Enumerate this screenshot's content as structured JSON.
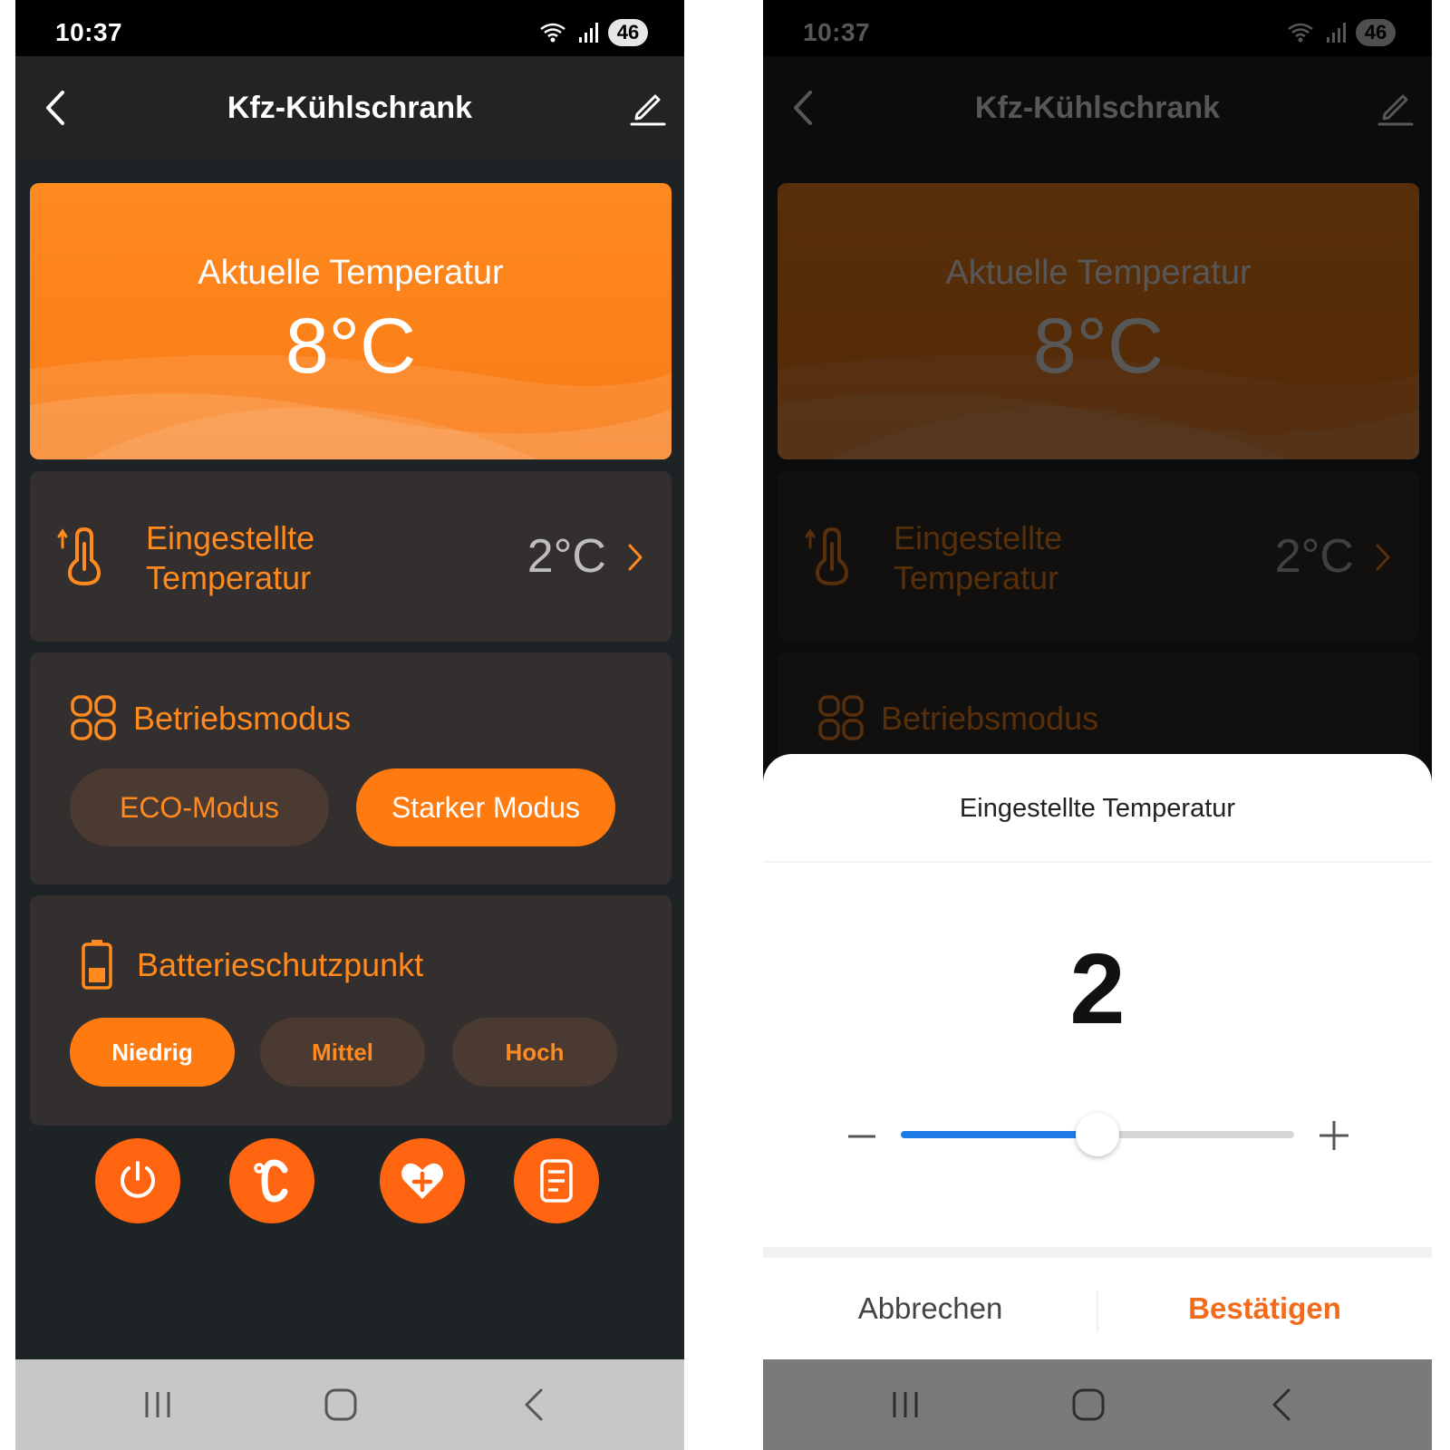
{
  "status": {
    "time": "10:37",
    "battery": "46"
  },
  "header": {
    "title": "Kfz-Kühlschrank"
  },
  "current_temp": {
    "label": "Aktuelle Temperatur",
    "value": "8°C"
  },
  "setpoint": {
    "label_line1": "Eingestellte",
    "label_line2": "Temperatur",
    "value": "2°C"
  },
  "mode": {
    "title": "Betriebsmodus",
    "options": [
      "ECO-Modus",
      "Starker Modus"
    ],
    "selected": "Starker Modus"
  },
  "battery_protect": {
    "title": "Batterieschutzpunkt",
    "options": [
      "Niedrig",
      "Mittel",
      "Hoch"
    ],
    "selected": "Niedrig"
  },
  "quick_actions": [
    "power-icon",
    "celsius-icon",
    "heart-plus-icon",
    "document-icon"
  ],
  "dialog": {
    "title": "Eingestellte Temperatur",
    "value": "2",
    "slider_fraction": 0.5,
    "cancel_label": "Abbrechen",
    "confirm_label": "Bestätigen"
  },
  "colors": {
    "accent": "#ff7a0f",
    "card": "#332f2e",
    "background": "#1e2426",
    "slider": "#1e7be6",
    "confirm": "#f26a1b"
  }
}
